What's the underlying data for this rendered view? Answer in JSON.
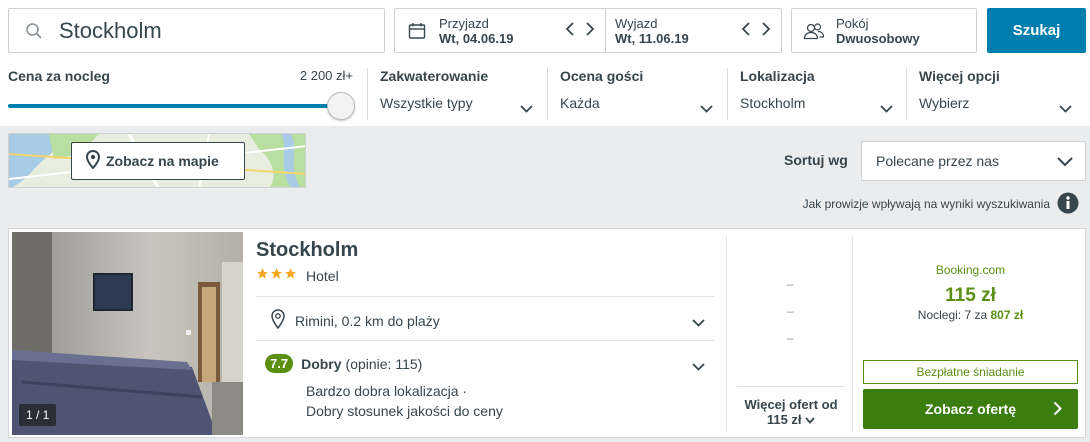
{
  "search": {
    "destination": "Stockholm"
  },
  "dates": {
    "checkin_label": "Przyjazd",
    "checkin_value": "Wt, 04.06.19",
    "checkout_label": "Wyjazd",
    "checkout_value": "Wt, 11.06.19"
  },
  "room": {
    "label": "Pokój",
    "value": "Dwuosobowy"
  },
  "search_button": "Szukaj",
  "filters": {
    "price_label": "Cena za nocleg",
    "price_max": "2 200 zł+",
    "price_slider_fraction": 1.0,
    "accommodation": {
      "title": "Zakwaterowanie",
      "value": "Wszystkie typy"
    },
    "rating": {
      "title": "Ocena gości",
      "value": "Każda"
    },
    "location": {
      "title": "Lokalizacja",
      "value": "Stockholm"
    },
    "more": {
      "title": "Więcej opcji",
      "value": "Wybierz"
    }
  },
  "map_button": "Zobacz na mapie",
  "sort": {
    "label": "Sortuj wg",
    "value": "Polecane przez nas"
  },
  "commission_text": "Jak prowizje wpływają na wyniki wyszukiwania",
  "hotel": {
    "name": "Stockholm",
    "stars": 3,
    "type": "Hotel",
    "location": "Rimini, 0.2 km do plaży",
    "rating_score": "7.7",
    "rating_word": "Dobry",
    "rating_reviews": "(opinie: 115)",
    "pro1": "Bardzo dobra lokalizacja",
    "pro_sep": "·",
    "pro2": "Dobry stosunek jakości do ceny",
    "photo_count": "1 / 1",
    "dashes": [
      "–",
      "–",
      "–"
    ],
    "more_offers_line1": "Więcej ofert od",
    "more_offers_line2": "115 zł",
    "provider": "Booking.com",
    "price": "115 zł",
    "nights_prefix": "Noclegi: 7 za",
    "nights_total": "807 zł",
    "breakfast": "Bezpłatne śniadanie",
    "offer_button": "Zobacz ofertę"
  },
  "colors": {
    "accent": "#007faf",
    "green": "#5a8f11",
    "button_green": "#3b7e0f",
    "star": "#f5a623"
  }
}
